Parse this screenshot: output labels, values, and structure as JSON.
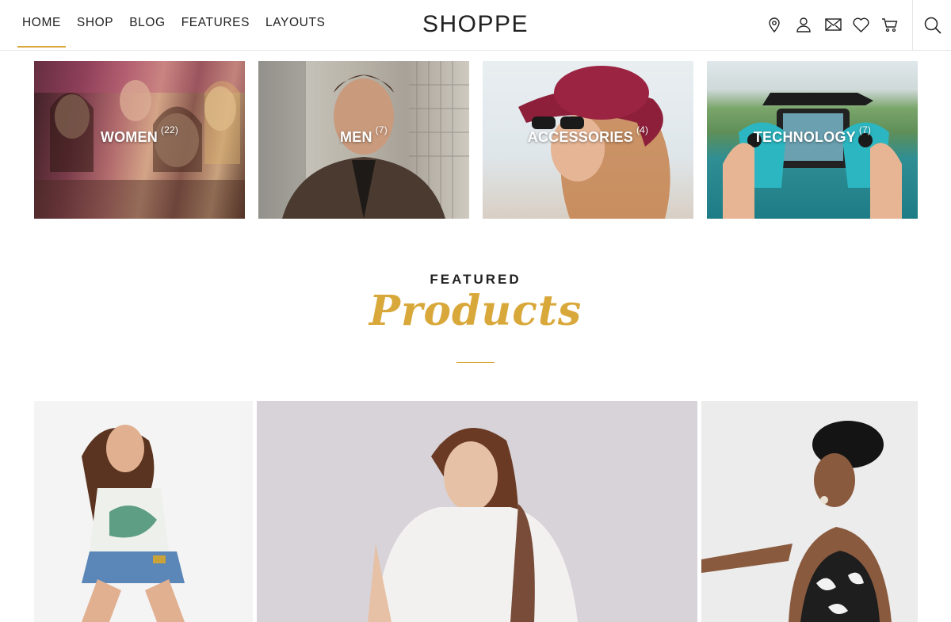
{
  "nav": {
    "items": [
      {
        "label": "HOME",
        "active": true
      },
      {
        "label": "SHOP"
      },
      {
        "label": "BLOG"
      },
      {
        "label": "FEATURES"
      },
      {
        "label": "LAYOUTS"
      }
    ]
  },
  "brand": {
    "logo": "SHOPPE",
    "accent": "#d9a83a"
  },
  "header_icons": [
    "location-pin-icon",
    "user-icon",
    "mail-icon",
    "heart-icon",
    "cart-icon",
    "search-icon"
  ],
  "categories": [
    {
      "name": "WOMEN",
      "count": "(22)"
    },
    {
      "name": "MEN",
      "count": "(7)"
    },
    {
      "name": "ACCESSORIES",
      "count": "(4)"
    },
    {
      "name": "TECHNOLOGY",
      "count": "(7)"
    }
  ],
  "featured": {
    "kicker": "FEATURED",
    "title": "Products"
  }
}
